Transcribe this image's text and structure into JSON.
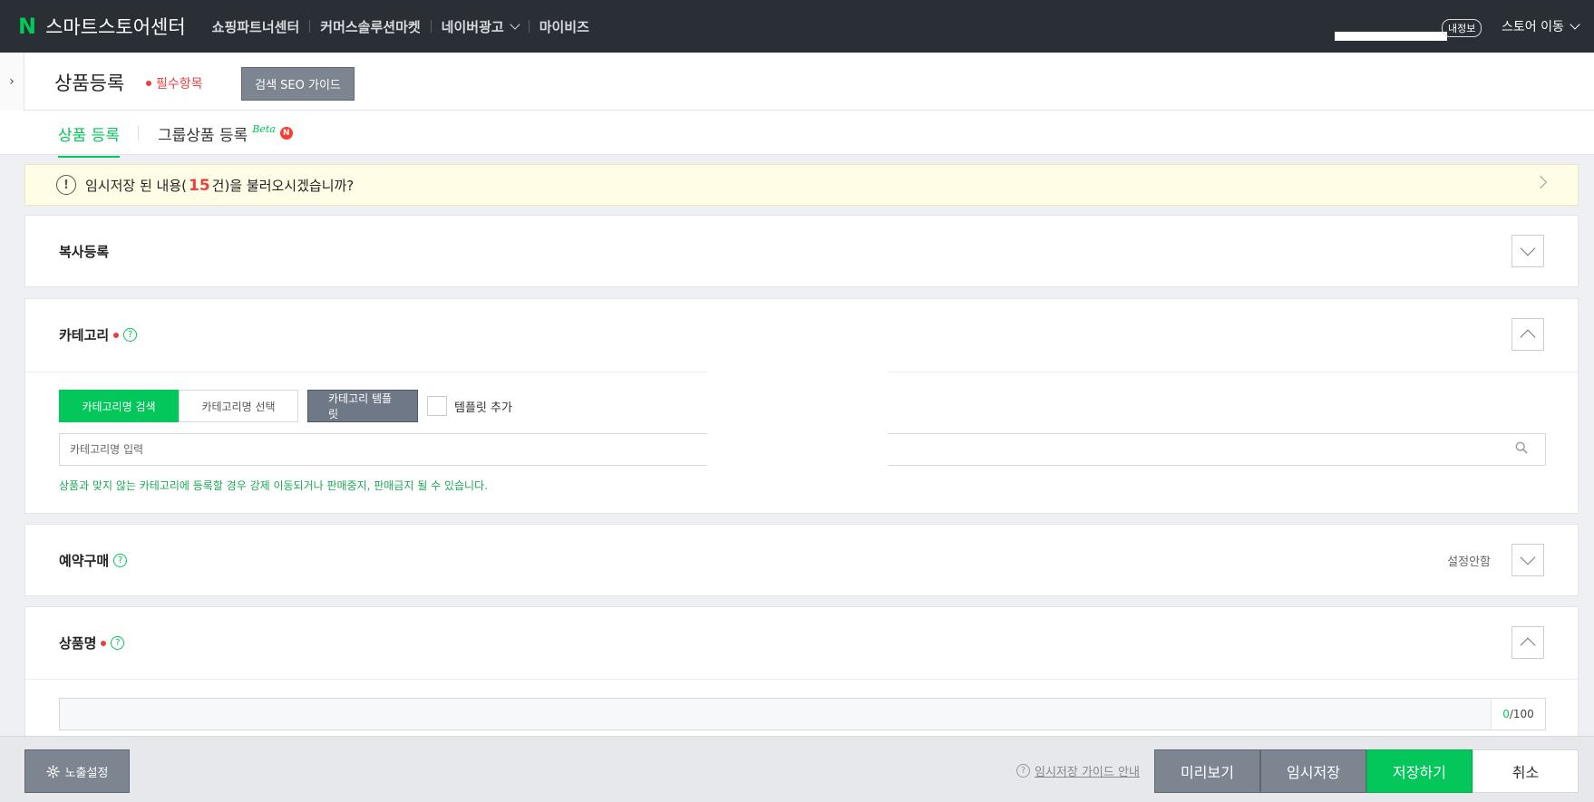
{
  "topbar": {
    "logo_letter": "N",
    "logo_text": "스마트스토어센터",
    "nav": [
      "쇼핑파트너센터",
      "커머스솔루션마켓",
      "네이버광고",
      "마이비즈"
    ],
    "my_info": "내정보",
    "store_move": "스토어 이동"
  },
  "header": {
    "title": "상품등록",
    "required": "필수항목",
    "seo_guide": "검색 SEO 가이드"
  },
  "tabs": {
    "product": "상품 등록",
    "group": "그룹상품 등록",
    "beta": "Beta",
    "new_badge": "N"
  },
  "banner": {
    "text_before": "임시저장 된 내용(",
    "count": "15",
    "text_after": "건)을 불러오시겠습니까?"
  },
  "sections": {
    "copy": {
      "title": "복사등록"
    },
    "category": {
      "title": "카테고리",
      "btn_search": "카테고리명 검색",
      "btn_select": "카테고리명 선택",
      "btn_template": "카테고리 템플릿",
      "template_add": "템플릿 추가",
      "input_placeholder": "카테고리명 입력",
      "note": "상품과 맞지 않는 카테고리에 등록할 경우 강제 이동되거나 판매중지, 판매금지 될 수 있습니다."
    },
    "preorder": {
      "title": "예약구매",
      "status": "설정안함"
    },
    "product_name": {
      "title": "상품명",
      "count": "0",
      "max": "/100"
    }
  },
  "bottom": {
    "expose": "노출설정",
    "guide": "임시저장 가이드 안내",
    "preview": "미리보기",
    "temp_save": "임시저장",
    "save": "저장하기",
    "cancel": "취소"
  },
  "colors": {
    "accent": "#03c75a",
    "topbar": "#2a2f35",
    "required": "#e94040",
    "banner_bg": "#fffde6"
  }
}
